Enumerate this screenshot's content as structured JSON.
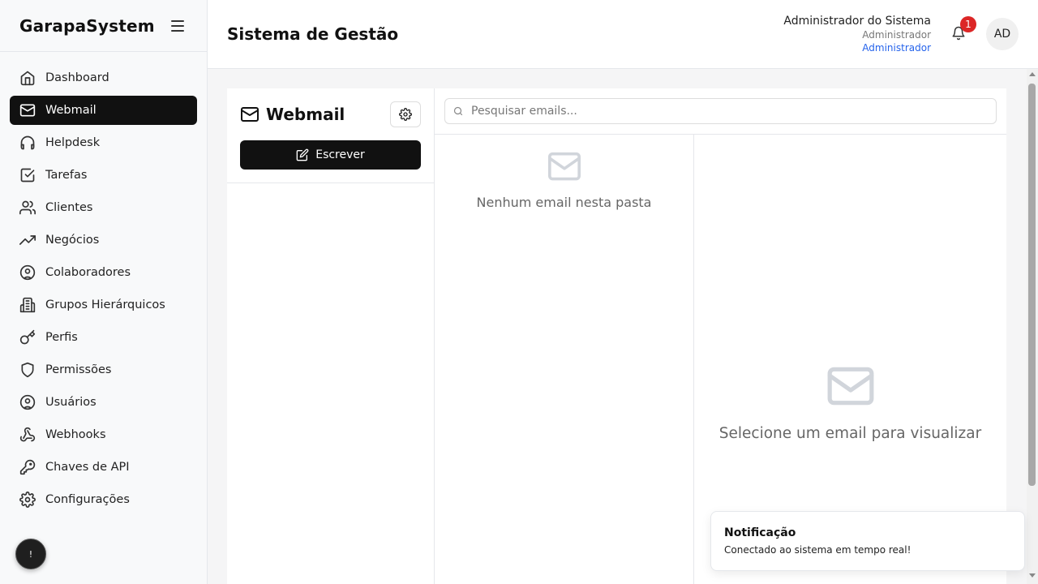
{
  "app": {
    "brand": "GarapaSystem"
  },
  "sidebar": {
    "items": [
      {
        "label": "Dashboard",
        "icon": "home-icon"
      },
      {
        "label": "Webmail",
        "icon": "mail-icon",
        "active": true
      },
      {
        "label": "Helpdesk",
        "icon": "headphones-icon"
      },
      {
        "label": "Tarefas",
        "icon": "checkbox-icon"
      },
      {
        "label": "Clientes",
        "icon": "users-icon"
      },
      {
        "label": "Negócios",
        "icon": "trending-up-icon"
      },
      {
        "label": "Colaboradores",
        "icon": "user-circle-icon"
      },
      {
        "label": "Grupos Hierárquicos",
        "icon": "building-icon"
      },
      {
        "label": "Perfis",
        "icon": "key-icon"
      },
      {
        "label": "Permissões",
        "icon": "shield-icon"
      },
      {
        "label": "Usuários",
        "icon": "user-circle-icon"
      },
      {
        "label": "Webhooks",
        "icon": "webhook-icon"
      },
      {
        "label": "Chaves de API",
        "icon": "key-round-icon"
      },
      {
        "label": "Configurações",
        "icon": "gear-icon"
      }
    ],
    "bottom_button": "!"
  },
  "header": {
    "title": "Sistema de Gestão",
    "user_name": "Administrador do Sistema",
    "user_role": "Administrador",
    "user_link": "Administrador",
    "notification_count": "1",
    "avatar_initials": "AD"
  },
  "webmail": {
    "title": "Webmail",
    "compose_label": "Escrever",
    "search_placeholder": "Pesquisar emails...",
    "empty_folder_text": "Nenhum email nesta pasta",
    "select_email_text": "Selecione um email para visualizar"
  },
  "toast": {
    "title": "Notificação",
    "message": "Conectado ao sistema em tempo real!"
  },
  "colors": {
    "active_nav_bg": "#111111",
    "badge": "#dc2626",
    "link": "#2563eb"
  }
}
